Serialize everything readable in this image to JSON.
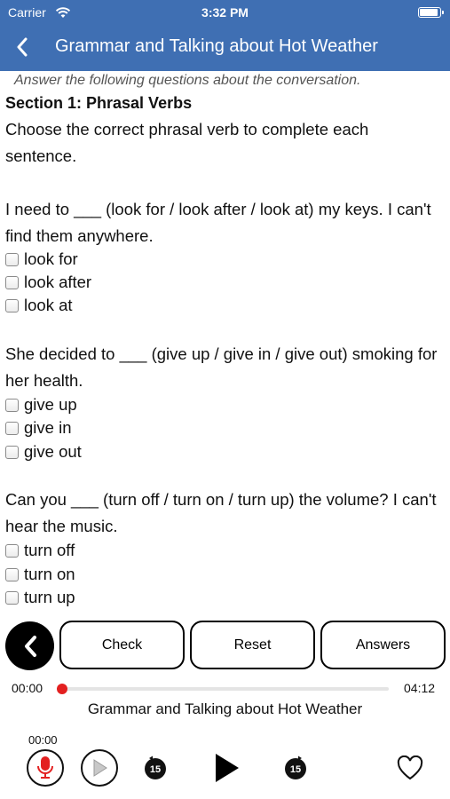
{
  "status_bar": {
    "carrier": "Carrier",
    "time": "3:32 PM"
  },
  "nav": {
    "title": "Grammar and Talking about Hot Weather",
    "back_icon": "chevron-left-icon"
  },
  "content": {
    "instruction": "Answer the following questions about the conversation.",
    "section_title": "Section 1: Phrasal Verbs",
    "section_desc": "Choose the correct phrasal verb to complete each sentence.",
    "questions": [
      {
        "text": "I need to ___ (look for / look after / look at) my keys. I can't find them anywhere.",
        "options": [
          "look for",
          "look after",
          "look at"
        ]
      },
      {
        "text": "She decided to ___ (give up / give in / give out) smoking for her health.",
        "options": [
          "give up",
          "give in",
          "give out"
        ]
      },
      {
        "text": "Can you ___ (turn off / turn on / turn up) the volume? I can't hear the music.",
        "options": [
          "turn off",
          "turn on",
          "turn up"
        ]
      }
    ]
  },
  "controls": {
    "check_label": "Check",
    "reset_label": "Reset",
    "answers_label": "Answers"
  },
  "player": {
    "current_time": "00:00",
    "total_time": "04:12",
    "progress": 0,
    "track_title": "Grammar and Talking about Hot Weather",
    "recording_time": "00:00",
    "skip_back_seconds": "15",
    "skip_forward_seconds": "15"
  },
  "colors": {
    "header": "#3f6fb3",
    "accent_red": "#e32020"
  }
}
